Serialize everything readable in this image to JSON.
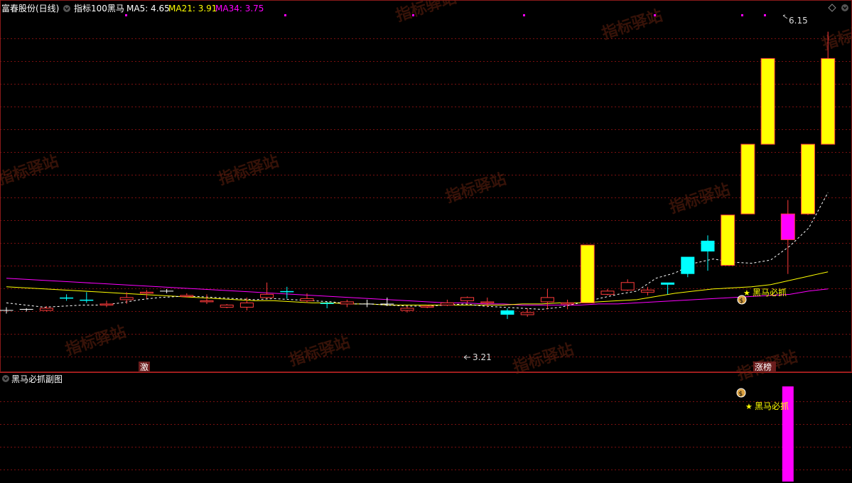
{
  "header": {
    "stock_name": "富春股份(日线)",
    "indicator_name": "指标100黑马",
    "ma5": {
      "label": "MA5: 4.65",
      "color": "#ffffff"
    },
    "ma21": {
      "label": "MA21: 3.91",
      "color": "#ffff00"
    },
    "ma34": {
      "label": "MA34: 3.75",
      "color": "#ff00ff"
    }
  },
  "sub_panel": {
    "title": "黑马必抓副图",
    "signal_label": "黑马必抓"
  },
  "main_panel": {
    "signal_label": "黑马必抓",
    "high_label": "6.15",
    "low_label": "3.21",
    "tag_left": "激",
    "tag_right": "涨榜"
  },
  "watermark": "指标驿站",
  "colors": {
    "up": "#ff3b3b",
    "down": "#00ffff",
    "signal_bar": "#ffff00",
    "signal_bar_edge": "#ff3b3b",
    "magenta": "#ff00ff",
    "grid": "#7a1010"
  },
  "chart_data": {
    "type": "candlestick",
    "x": [
      1,
      2,
      3,
      4,
      5,
      6,
      7,
      8,
      9,
      10,
      11,
      12,
      13,
      14,
      15,
      16,
      17,
      18,
      19,
      20,
      21,
      22,
      23,
      24,
      25,
      26,
      27,
      28,
      29,
      30,
      31,
      32,
      33,
      34,
      35,
      36,
      37,
      38,
      39,
      40,
      41,
      42
    ],
    "open": [
      3.55,
      3.56,
      3.55,
      3.67,
      3.65,
      3.6,
      3.65,
      3.71,
      3.73,
      3.68,
      3.63,
      3.58,
      3.58,
      3.67,
      3.73,
      3.64,
      3.62,
      3.61,
      3.61,
      3.61,
      3.55,
      3.58,
      3.6,
      3.64,
      3.62,
      3.55,
      3.51,
      3.63,
      3.61,
      3.65,
      3.7,
      3.74,
      3.72,
      3.81,
      4.05,
      4.2,
      4.14,
      4.11,
      3.97,
      3.9,
      3.89,
      4.21
    ],
    "close": [
      3.55,
      3.56,
      3.57,
      3.66,
      3.64,
      3.61,
      3.67,
      3.72,
      3.73,
      3.69,
      3.64,
      3.6,
      3.62,
      3.7,
      3.72,
      3.66,
      3.61,
      3.63,
      3.61,
      3.61,
      3.57,
      3.59,
      3.62,
      3.67,
      3.63,
      3.51,
      3.53,
      3.67,
      3.62,
      3.66,
      3.73,
      3.81,
      3.74,
      3.79,
      3.89,
      4.1,
      4.11,
      4.06,
      3.98,
      3.91,
      3.97,
      4.45
    ],
    "high": [
      3.58,
      3.57,
      3.59,
      3.7,
      3.72,
      3.64,
      3.72,
      3.74,
      3.75,
      3.71,
      3.7,
      3.61,
      3.67,
      3.81,
      3.77,
      3.71,
      3.63,
      3.65,
      3.65,
      3.67,
      3.59,
      3.6,
      3.65,
      3.68,
      3.67,
      3.57,
      3.57,
      3.75,
      3.65,
      3.7,
      3.75,
      3.84,
      3.77,
      3.8,
      3.98,
      4.25,
      4.16,
      4.12,
      4.0,
      3.96,
      4.02,
      5.5
    ],
    "low": [
      3.52,
      3.54,
      3.54,
      3.64,
      3.62,
      3.58,
      3.61,
      3.66,
      3.71,
      3.67,
      3.61,
      3.57,
      3.55,
      3.66,
      3.66,
      3.62,
      3.57,
      3.58,
      3.58,
      3.59,
      3.53,
      3.57,
      3.59,
      3.61,
      3.58,
      3.47,
      3.49,
      3.56,
      3.56,
      3.63,
      3.69,
      3.73,
      3.69,
      3.7,
      3.86,
      3.92,
      4.05,
      4.02,
      3.94,
      3.87,
      3.87,
      4.18
    ],
    "ma5": [
      3.62,
      3.6,
      3.58,
      3.59,
      3.6,
      3.6,
      3.62,
      3.65,
      3.67,
      3.68,
      3.68,
      3.67,
      3.66,
      3.65,
      3.66,
      3.65,
      3.64,
      3.63,
      3.61,
      3.61,
      3.6,
      3.59,
      3.59,
      3.6,
      3.61,
      3.59,
      3.58,
      3.57,
      3.56,
      3.58,
      3.62,
      3.66,
      3.7,
      3.73,
      3.85,
      3.9,
      3.99,
      4.03,
      4.0,
      3.99,
      4.02,
      4.15,
      4.32,
      4.65
    ],
    "ma21": [
      3.77,
      3.76,
      3.75,
      3.74,
      3.73,
      3.72,
      3.71,
      3.7,
      3.69,
      3.68,
      3.67,
      3.66,
      3.65,
      3.64,
      3.64,
      3.63,
      3.62,
      3.62,
      3.61,
      3.61,
      3.6,
      3.6,
      3.6,
      3.6,
      3.6,
      3.6,
      3.6,
      3.61,
      3.61,
      3.62,
      3.62,
      3.63,
      3.64,
      3.65,
      3.68,
      3.71,
      3.73,
      3.75,
      3.76,
      3.77,
      3.79,
      3.83,
      3.87,
      3.91
    ],
    "ma34": [
      3.85,
      3.84,
      3.83,
      3.82,
      3.81,
      3.8,
      3.79,
      3.78,
      3.77,
      3.76,
      3.75,
      3.74,
      3.73,
      3.72,
      3.71,
      3.7,
      3.69,
      3.68,
      3.67,
      3.66,
      3.65,
      3.64,
      3.63,
      3.62,
      3.62,
      3.61,
      3.61,
      3.6,
      3.6,
      3.6,
      3.6,
      3.61,
      3.61,
      3.62,
      3.63,
      3.64,
      3.65,
      3.66,
      3.67,
      3.68,
      3.69,
      3.7,
      3.73,
      3.75
    ],
    "signal_bars": [
      {
        "x": 30,
        "open": 3.62,
        "close": 4.16
      },
      {
        "x": 37,
        "open": 3.97,
        "close": 4.44
      },
      {
        "x": 38,
        "open": 4.45,
        "close": 5.1
      },
      {
        "x": 39,
        "open": 5.1,
        "close": 5.9
      }
    ],
    "last_candles": [
      {
        "x": 40,
        "open": 4.21,
        "close": 4.45,
        "high": 4.58,
        "low": 3.89
      },
      {
        "x": 41,
        "open": 4.45,
        "close": 5.1,
        "high": 5.1,
        "low": 4.44
      },
      {
        "x": 42,
        "open": 5.1,
        "close": 5.9,
        "high": 6.15,
        "low": 5.25
      }
    ],
    "ylim": [
      3.0,
      6.3
    ],
    "high_point": 6.15,
    "low_point": 3.21,
    "sub_signal": {
      "x": 40,
      "value": 1
    }
  }
}
